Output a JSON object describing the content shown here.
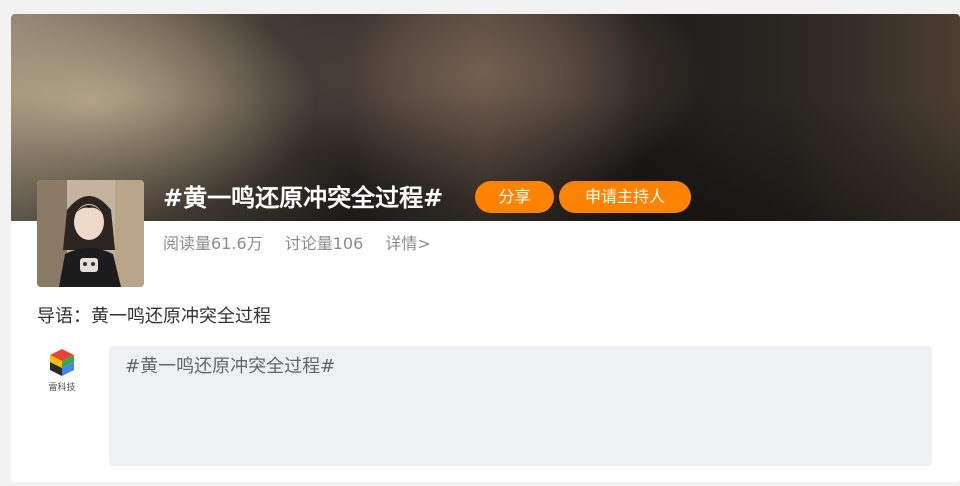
{
  "topic": {
    "title": "#黄一鸣还原冲突全过程#",
    "share_label": "分享",
    "apply_host_label": "申请主持人",
    "read_count": "阅读量61.6万",
    "discussion_count": "讨论量106",
    "details_label": "详情>",
    "intro": "导语：黄一鸣还原冲突全过程"
  },
  "composer": {
    "source_label": "雷科技",
    "text": "#黄一鸣还原冲突全过程#"
  },
  "colors": {
    "accent": "#ff8200",
    "input_bg": "#eff0f4",
    "muted_text": "#8c8c8c"
  }
}
